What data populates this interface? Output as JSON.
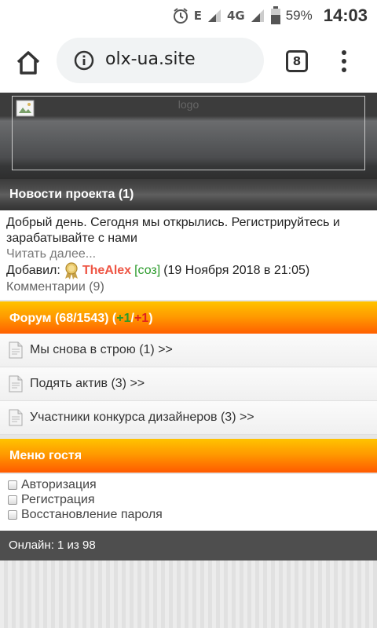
{
  "status_bar": {
    "network_e": "E",
    "network_4g": "4G",
    "battery": "59%",
    "time": "14:03"
  },
  "browser": {
    "url": "olx-ua.site",
    "tabs_count": "8"
  },
  "header": {
    "logo_alt": "logo"
  },
  "news": {
    "title": "Новости проекта (1)",
    "text": "Добрый день. Сегодня мы открылись. Регистрируйтесь и зарабатывайте с нами",
    "read_more": "Читать далее...",
    "added_label": "Добавил:",
    "author": "TheAlex",
    "author_tag": "[соз]",
    "date": "(19 Ноября 2018 в 21:05)",
    "comments": "Комментарии (9)"
  },
  "forum": {
    "title_prefix": "Форум (68/1543) (",
    "plus_green": "+1",
    "slash": "/",
    "plus_red": "+1",
    "title_suffix": ")",
    "topics": [
      {
        "label": "Мы снова в строю (1) >>"
      },
      {
        "label": "Подять актив (3) >>"
      },
      {
        "label": "Участники конкурса дизайнеров (3) >>"
      }
    ]
  },
  "guest_menu": {
    "title": "Меню гостя",
    "items": [
      {
        "label": "Авторизация"
      },
      {
        "label": "Регистрация"
      },
      {
        "label": "Восстановление пароля"
      }
    ]
  },
  "online": "Онлайн: 1 из 98",
  "colors": {
    "orange_top": "#ffc300",
    "orange_bottom": "#ff5a00",
    "dark_bar": "#4e4e4e",
    "author": "#ee5544",
    "green": "#2a9a2a"
  }
}
